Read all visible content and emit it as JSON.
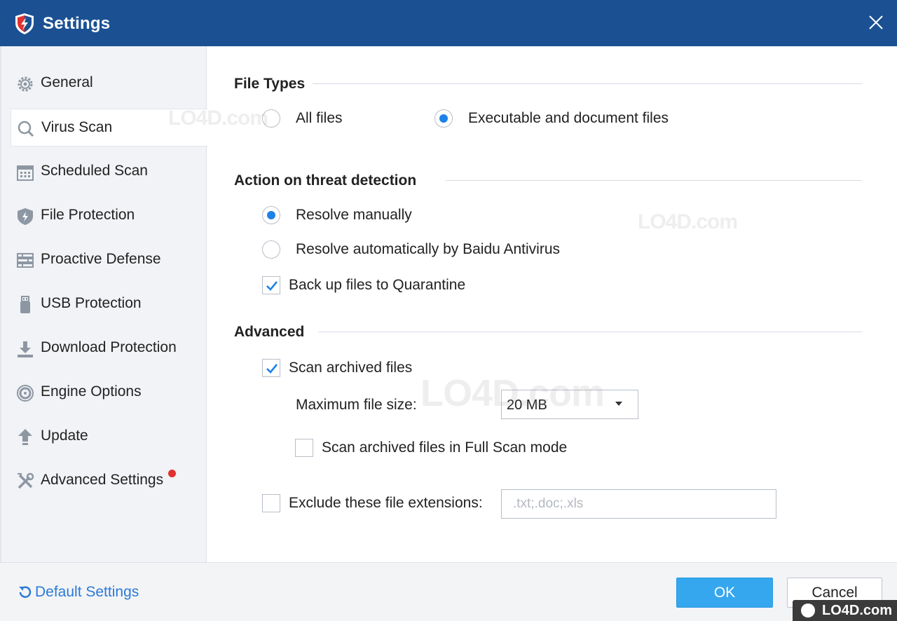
{
  "window": {
    "title": "Settings",
    "close_icon": "close-icon",
    "logo_icon": "shield-lightning-icon"
  },
  "sidebar": {
    "items": [
      {
        "label": "General",
        "icon": "gear-icon"
      },
      {
        "label": "Virus Scan",
        "icon": "search-icon",
        "active": true
      },
      {
        "label": "Scheduled Scan",
        "icon": "calendar-icon"
      },
      {
        "label": "File Protection",
        "icon": "shield-icon"
      },
      {
        "label": "Proactive Defense",
        "icon": "firewall-icon"
      },
      {
        "label": "USB Protection",
        "icon": "usb-icon"
      },
      {
        "label": "Download Protection",
        "icon": "download-icon"
      },
      {
        "label": "Engine Options",
        "icon": "engine-icon"
      },
      {
        "label": "Update",
        "icon": "upload-arrow-icon"
      },
      {
        "label": "Advanced Settings",
        "icon": "tools-icon",
        "badge": "red-dot"
      }
    ]
  },
  "file_types": {
    "title": "File Types",
    "all_files": "All files",
    "exe_doc": "Executable and document files",
    "selected": "exe_doc"
  },
  "threat_action": {
    "title": "Action on threat detection",
    "manual": "Resolve manually",
    "auto": "Resolve automatically by Baidu Antivirus",
    "selected": "manual",
    "backup_label": "Back up files to Quarantine",
    "backup_checked": true
  },
  "advanced": {
    "title": "Advanced",
    "scan_archived_label": "Scan archived files",
    "scan_archived_checked": true,
    "max_size_label": "Maximum file size:",
    "max_size_value": "20 MB",
    "full_scan_label": "Scan archived files in Full Scan mode",
    "full_scan_checked": false,
    "exclude_label": "Exclude these file extensions:",
    "exclude_checked": false,
    "exclude_placeholder": ".txt;.doc;.xls"
  },
  "footer": {
    "default_settings": "Default Settings",
    "ok": "OK",
    "cancel": "Cancel"
  },
  "watermark": "LO4D.com",
  "colors": {
    "titlebar": "#1b5193",
    "accent": "#1d82e8",
    "ok_button": "#35a7ef",
    "link": "#2b7ad6"
  }
}
